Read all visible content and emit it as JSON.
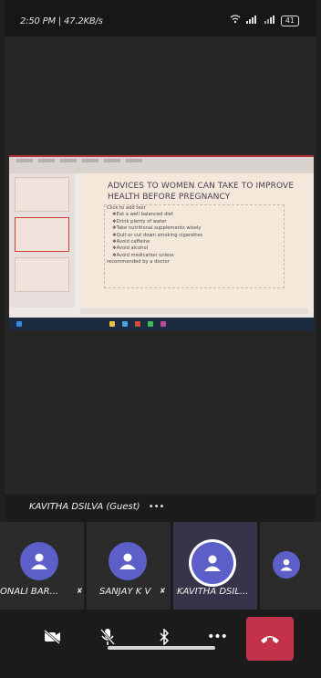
{
  "status_bar": {
    "time": "2:50 PM | 47.2KB/s",
    "battery": "41"
  },
  "presentation": {
    "slide_title": "ADVICES TO WOMEN CAN TAKE TO IMPROVE HEALTH BEFORE PREGNANCY",
    "placeholder": "Click to add text",
    "bullets": [
      "❖Eat a well balanced diet",
      "❖Drink plenty of water",
      "❖Take nutritional supplements wisely",
      "❖Quit or cut down smoking cigarettes",
      "❖Avoid caffeine",
      "❖Avoid alcohol",
      "❖Avoid medication unless",
      "recommended by a doctor"
    ]
  },
  "presenter": {
    "name": "KAVITHA DSILVA (Guest)",
    "more": "•••"
  },
  "participants": [
    {
      "name": "ONALI BAR...",
      "icon": "avatar-icon"
    },
    {
      "name": "SANJAY K V",
      "icon": "avatar-icon"
    },
    {
      "name": "KAVITHA DSIL...",
      "icon": "avatar-icon",
      "active": true
    },
    {
      "name": "",
      "icon": "avatar-icon"
    }
  ],
  "controls": {
    "more_label": "•••",
    "icons": [
      "video-off-icon",
      "mic-off-icon",
      "bluetooth-icon",
      "more-icon",
      "hang-up-icon"
    ],
    "hangup_color": "#c4314b"
  },
  "colors": {
    "accent": "#5b5fc7",
    "background": "#1f1f1f"
  }
}
